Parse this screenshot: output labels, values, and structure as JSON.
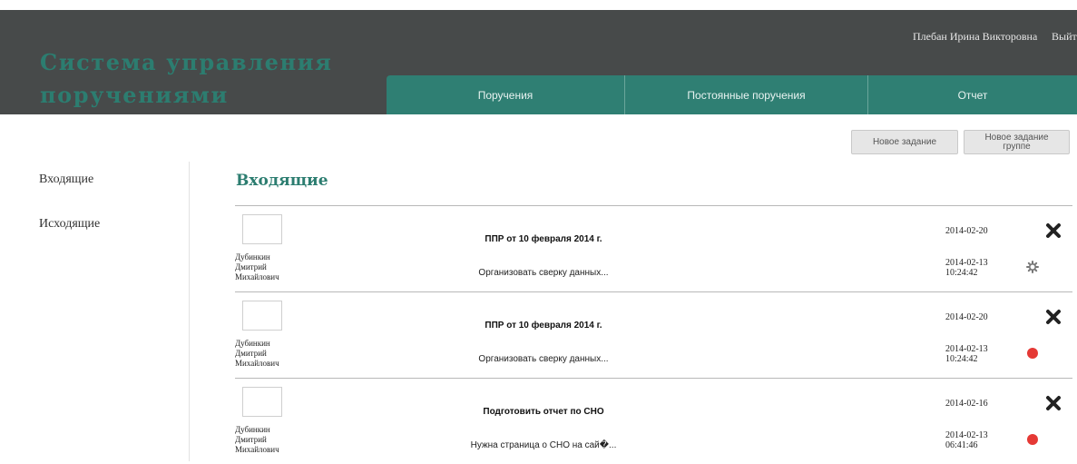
{
  "header": {
    "app_title": "Система управления поручениями",
    "user_name": "Плебан Ирина Викторовна",
    "logout_label": "Выйт"
  },
  "nav": {
    "tabs": [
      {
        "label": "Поручения"
      },
      {
        "label": "Постоянные поручения"
      },
      {
        "label": "Отчет"
      }
    ]
  },
  "toolbar": {
    "new_task_label": "Новое задание",
    "new_group_task_line1": "Новое задание",
    "new_group_task_line2": "группе"
  },
  "sidebar": {
    "items": [
      {
        "label": "Входящие"
      },
      {
        "label": "Исходящие"
      }
    ]
  },
  "main": {
    "section_title": "Входящие",
    "tasks": [
      {
        "author_line1": "Дубинкин",
        "author_line2": "Дмитрий",
        "author_line3": "Михайлович",
        "title": "ППР от 10 февраля 2014 г.",
        "description": "Организовать сверку данных...",
        "due_date": "2014-02-20",
        "created_date": "2014-02-13",
        "created_time": "10:24:42",
        "status": "gear-icon"
      },
      {
        "author_line1": "Дубинкин",
        "author_line2": "Дмитрий",
        "author_line3": "Михайлович",
        "title": "ППР от 10 февраля 2014 г.",
        "description": "Организовать сверку данных...",
        "due_date": "2014-02-20",
        "created_date": "2014-02-13",
        "created_time": "10:24:42",
        "status": "red-dot-icon"
      },
      {
        "author_line1": "Дубинкин",
        "author_line2": "Дмитрий",
        "author_line3": "Михайлович",
        "title": "Подготовить отчет по СНО",
        "description": "Нужна страница о СНО на сай�...",
        "due_date": "2014-02-16",
        "created_date": "2014-02-13",
        "created_time": "06:41:46",
        "status": "red-dot-icon"
      }
    ]
  },
  "colors": {
    "header_bg": "#474a4a",
    "accent": "#2c7d70",
    "nav_tab": "#2f7f73",
    "status_red": "#e53935"
  }
}
